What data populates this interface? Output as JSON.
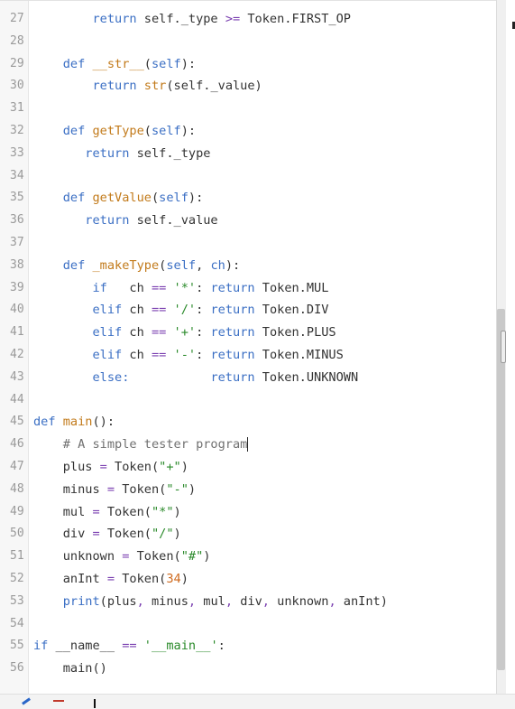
{
  "lines": [
    {
      "num": "27",
      "tokens": [
        {
          "t": "        "
        },
        {
          "t": "return",
          "c": "k"
        },
        {
          "t": " self._type "
        },
        {
          "t": ">=",
          "c": "o"
        },
        {
          "t": " Token.FIRST_OP"
        }
      ]
    },
    {
      "num": "28",
      "tokens": []
    },
    {
      "num": "29",
      "tokens": [
        {
          "t": "    "
        },
        {
          "t": "def",
          "c": "k"
        },
        {
          "t": " "
        },
        {
          "t": "__str__",
          "c": "f"
        },
        {
          "t": "("
        },
        {
          "t": "self",
          "c": "k"
        },
        {
          "t": "):"
        }
      ]
    },
    {
      "num": "30",
      "tokens": [
        {
          "t": "        "
        },
        {
          "t": "return",
          "c": "k"
        },
        {
          "t": " "
        },
        {
          "t": "str",
          "c": "f"
        },
        {
          "t": "(self._value)"
        }
      ]
    },
    {
      "num": "31",
      "tokens": []
    },
    {
      "num": "32",
      "tokens": [
        {
          "t": "    "
        },
        {
          "t": "def",
          "c": "k"
        },
        {
          "t": " "
        },
        {
          "t": "getType",
          "c": "f"
        },
        {
          "t": "("
        },
        {
          "t": "self",
          "c": "k"
        },
        {
          "t": "):"
        }
      ]
    },
    {
      "num": "33",
      "tokens": [
        {
          "t": "       "
        },
        {
          "t": "return",
          "c": "k"
        },
        {
          "t": " self._type"
        }
      ]
    },
    {
      "num": "34",
      "tokens": []
    },
    {
      "num": "35",
      "tokens": [
        {
          "t": "    "
        },
        {
          "t": "def",
          "c": "k"
        },
        {
          "t": " "
        },
        {
          "t": "getValue",
          "c": "f"
        },
        {
          "t": "("
        },
        {
          "t": "self",
          "c": "k"
        },
        {
          "t": "):"
        }
      ]
    },
    {
      "num": "36",
      "tokens": [
        {
          "t": "       "
        },
        {
          "t": "return",
          "c": "k"
        },
        {
          "t": " self._value"
        }
      ]
    },
    {
      "num": "37",
      "tokens": []
    },
    {
      "num": "38",
      "tokens": [
        {
          "t": "    "
        },
        {
          "t": "def",
          "c": "k"
        },
        {
          "t": " "
        },
        {
          "t": "_makeType",
          "c": "f"
        },
        {
          "t": "("
        },
        {
          "t": "self",
          "c": "k"
        },
        {
          "t": ", "
        },
        {
          "t": "ch",
          "c": "k"
        },
        {
          "t": "):"
        }
      ]
    },
    {
      "num": "39",
      "tokens": [
        {
          "t": "        "
        },
        {
          "t": "if",
          "c": "k"
        },
        {
          "t": "   ch "
        },
        {
          "t": "==",
          "c": "o"
        },
        {
          "t": " "
        },
        {
          "t": "'*'",
          "c": "s"
        },
        {
          "t": ": "
        },
        {
          "t": "return",
          "c": "k"
        },
        {
          "t": " Token.MUL"
        }
      ]
    },
    {
      "num": "40",
      "tokens": [
        {
          "t": "        "
        },
        {
          "t": "elif",
          "c": "k"
        },
        {
          "t": " ch "
        },
        {
          "t": "==",
          "c": "o"
        },
        {
          "t": " "
        },
        {
          "t": "'/'",
          "c": "s"
        },
        {
          "t": ": "
        },
        {
          "t": "return",
          "c": "k"
        },
        {
          "t": " Token.DIV"
        }
      ]
    },
    {
      "num": "41",
      "tokens": [
        {
          "t": "        "
        },
        {
          "t": "elif",
          "c": "k"
        },
        {
          "t": " ch "
        },
        {
          "t": "==",
          "c": "o"
        },
        {
          "t": " "
        },
        {
          "t": "'+'",
          "c": "s"
        },
        {
          "t": ": "
        },
        {
          "t": "return",
          "c": "k"
        },
        {
          "t": " Token.PLUS"
        }
      ]
    },
    {
      "num": "42",
      "tokens": [
        {
          "t": "        "
        },
        {
          "t": "elif",
          "c": "k"
        },
        {
          "t": " ch "
        },
        {
          "t": "==",
          "c": "o"
        },
        {
          "t": " "
        },
        {
          "t": "'-'",
          "c": "s"
        },
        {
          "t": ": "
        },
        {
          "t": "return",
          "c": "k"
        },
        {
          "t": " Token.MINUS"
        }
      ]
    },
    {
      "num": "43",
      "tokens": [
        {
          "t": "        "
        },
        {
          "t": "else:",
          "c": "k"
        },
        {
          "t": "           "
        },
        {
          "t": "return",
          "c": "k"
        },
        {
          "t": " Token.UNKNOWN"
        }
      ]
    },
    {
      "num": "44",
      "tokens": []
    },
    {
      "num": "45",
      "tokens": [
        {
          "t": "def",
          "c": "k"
        },
        {
          "t": " "
        },
        {
          "t": "main",
          "c": "f"
        },
        {
          "t": "():"
        }
      ]
    },
    {
      "num": "46",
      "tokens": [
        {
          "t": "    "
        },
        {
          "t": "# A simple tester program",
          "c": "c"
        }
      ],
      "cursor": true
    },
    {
      "num": "47",
      "tokens": [
        {
          "t": "    plus "
        },
        {
          "t": "=",
          "c": "o"
        },
        {
          "t": " Token("
        },
        {
          "t": "\"+\"",
          "c": "s"
        },
        {
          "t": ")"
        }
      ]
    },
    {
      "num": "48",
      "tokens": [
        {
          "t": "    minus "
        },
        {
          "t": "=",
          "c": "o"
        },
        {
          "t": " Token("
        },
        {
          "t": "\"-\"",
          "c": "s"
        },
        {
          "t": ")"
        }
      ]
    },
    {
      "num": "49",
      "tokens": [
        {
          "t": "    mul "
        },
        {
          "t": "=",
          "c": "o"
        },
        {
          "t": " Token("
        },
        {
          "t": "\"*\"",
          "c": "s"
        },
        {
          "t": ")"
        }
      ]
    },
    {
      "num": "50",
      "tokens": [
        {
          "t": "    div "
        },
        {
          "t": "=",
          "c": "o"
        },
        {
          "t": " Token("
        },
        {
          "t": "\"/\"",
          "c": "s"
        },
        {
          "t": ")"
        }
      ]
    },
    {
      "num": "51",
      "tokens": [
        {
          "t": "    unknown "
        },
        {
          "t": "=",
          "c": "o"
        },
        {
          "t": " Token("
        },
        {
          "t": "\"#\"",
          "c": "s"
        },
        {
          "t": ")"
        }
      ]
    },
    {
      "num": "52",
      "tokens": [
        {
          "t": "    anInt "
        },
        {
          "t": "=",
          "c": "o"
        },
        {
          "t": " Token("
        },
        {
          "t": "34",
          "c": "n"
        },
        {
          "t": ")"
        }
      ]
    },
    {
      "num": "53",
      "tokens": [
        {
          "t": "    "
        },
        {
          "t": "print",
          "c": "k"
        },
        {
          "t": "(plus"
        },
        {
          "t": ",",
          "c": "o"
        },
        {
          "t": " minus"
        },
        {
          "t": ",",
          "c": "o"
        },
        {
          "t": " mul"
        },
        {
          "t": ",",
          "c": "o"
        },
        {
          "t": " div"
        },
        {
          "t": ",",
          "c": "o"
        },
        {
          "t": " unknown"
        },
        {
          "t": ",",
          "c": "o"
        },
        {
          "t": " anInt)"
        }
      ]
    },
    {
      "num": "54",
      "tokens": []
    },
    {
      "num": "55",
      "tokens": [
        {
          "t": "if",
          "c": "k"
        },
        {
          "t": " __name__ "
        },
        {
          "t": "==",
          "c": "o"
        },
        {
          "t": " "
        },
        {
          "t": "'__main__'",
          "c": "s"
        },
        {
          "t": ":"
        }
      ]
    },
    {
      "num": "56",
      "tokens": [
        {
          "t": "    main()"
        }
      ]
    }
  ],
  "colors": {
    "keyword": "#3b6fc4",
    "function": "#c27a1a",
    "string": "#2a8a2a",
    "number": "#cf6a1e",
    "comment": "#707070",
    "gutter_bg": "#f7f7f7"
  },
  "bottom_toolbar": {
    "icons": [
      "pencil-icon",
      "trash-icon",
      "text-cursor-icon"
    ]
  }
}
